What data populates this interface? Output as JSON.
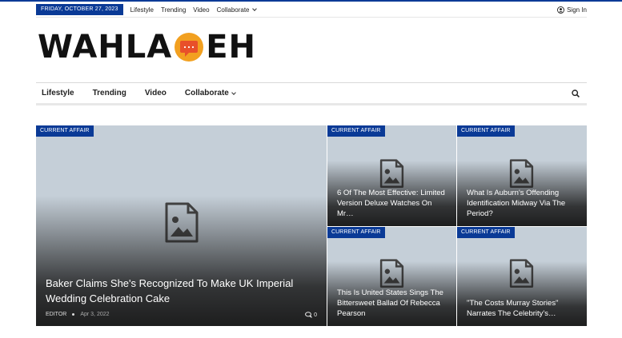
{
  "topbar": {
    "date": "FRIDAY, OCTOBER 27, 2023",
    "nav": [
      "Lifestyle",
      "Trending",
      "Video",
      "Collaborate"
    ],
    "signin": "Sign In"
  },
  "logo": {
    "left": "WAHLA",
    "right": "EH",
    "mark_text": "..."
  },
  "mainnav": {
    "items": [
      "Lifestyle",
      "Trending",
      "Video",
      "Collaborate"
    ]
  },
  "featured": {
    "category": "CURRENT AFFAIR",
    "title": "Baker Claims She's Recognized To Make UK Imperial Wedding Celebration Cake",
    "author": "EDITOR",
    "date": "Apr 3, 2022",
    "comments": "0"
  },
  "grid": [
    {
      "category": "CURRENT AFFAIR",
      "title": "6 Of The Most Effective: Limited Version Deluxe Watches On Mr…"
    },
    {
      "category": "CURRENT AFFAIR",
      "title": "What Is Auburn's Offending Identification Midway Via The Period?"
    },
    {
      "category": "CURRENT AFFAIR",
      "title": "This Is United States Sings The Bittersweet Ballad Of Rebecca Pearson"
    },
    {
      "category": "CURRENT AFFAIR",
      "title": "\"The Costs Murray Stories\" Narrates The Celebrity's…"
    }
  ],
  "colors": {
    "accent": "#0a3a96",
    "logo_mark": "#e8502a"
  }
}
